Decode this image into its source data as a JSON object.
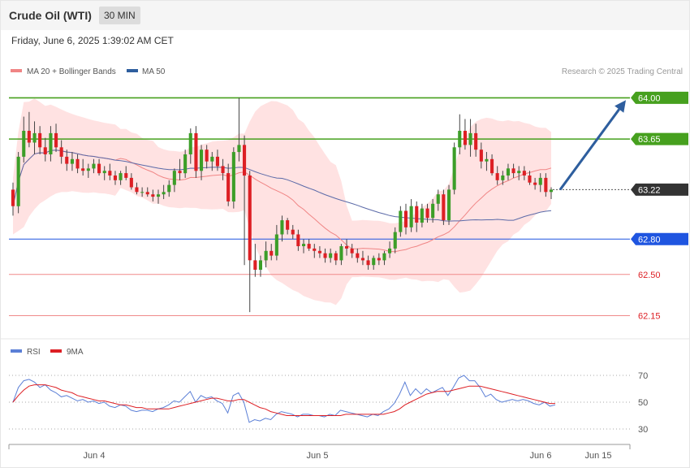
{
  "header": {
    "title": "Crude Oil (WTI)",
    "interval": "30 MIN",
    "timestamp": "Friday, June 6, 2025 1:39:02 AM CET"
  },
  "legend": {
    "ma20_label": "MA 20 + Bollinger Bands",
    "ma50_label": "MA 50",
    "copyright": "Research © 2025 Trading Central",
    "rsi_label": "RSI",
    "rsi_ma_label": "9MA"
  },
  "colors": {
    "up": "#3c9e28",
    "down": "#dd1f24",
    "ma20": "#f08585",
    "ma50": "#5b6aa8",
    "band_fill": "#ffdddd",
    "resistance": "#46a01e",
    "support": "#1f55e0",
    "target": "#f08a8a",
    "current": "#333333",
    "arrow": "#2e5e9e",
    "rsi": "#5b7fd6",
    "rsi_ma": "#dd1f24"
  },
  "chart_data": [
    {
      "type": "candlestick",
      "title": "Crude Oil (WTI)",
      "ylim": [
        62.05,
        64.12
      ],
      "x_ticks": [
        "Jun 4",
        "Jun 5",
        "Jun 6",
        "Jun 15"
      ],
      "levels": [
        {
          "value": 64.0,
          "label": "64.00",
          "kind": "resistance"
        },
        {
          "value": 63.65,
          "label": "63.65",
          "kind": "resistance"
        },
        {
          "value": 63.22,
          "label": "63.22",
          "kind": "current"
        },
        {
          "value": 62.8,
          "label": "62.80",
          "kind": "support"
        },
        {
          "value": 62.5,
          "label": "62.50",
          "kind": "target"
        },
        {
          "value": 62.15,
          "label": "62.15",
          "kind": "target"
        }
      ],
      "forecast_arrow": {
        "from": 63.22,
        "to": 63.98
      },
      "candles": [
        [
          63.22,
          63.28,
          63.0,
          63.08
        ],
        [
          63.08,
          63.54,
          63.02,
          63.5
        ],
        [
          63.5,
          63.84,
          63.45,
          63.72
        ],
        [
          63.72,
          63.88,
          63.58,
          63.62
        ],
        [
          63.62,
          63.8,
          63.52,
          63.7
        ],
        [
          63.7,
          63.76,
          63.52,
          63.58
        ],
        [
          63.58,
          63.66,
          63.46,
          63.52
        ],
        [
          63.52,
          63.76,
          63.46,
          63.7
        ],
        [
          63.7,
          63.78,
          63.54,
          63.58
        ],
        [
          63.58,
          63.64,
          63.44,
          63.5
        ],
        [
          63.5,
          63.56,
          63.38,
          63.44
        ],
        [
          63.44,
          63.54,
          63.38,
          63.48
        ],
        [
          63.48,
          63.52,
          63.36,
          63.4
        ],
        [
          63.4,
          63.48,
          63.34,
          63.38
        ],
        [
          63.38,
          63.44,
          63.32,
          63.4
        ],
        [
          63.4,
          63.48,
          63.36,
          63.44
        ],
        [
          63.44,
          63.48,
          63.34,
          63.36
        ],
        [
          63.36,
          63.42,
          63.3,
          63.38
        ],
        [
          63.38,
          63.44,
          63.3,
          63.34
        ],
        [
          63.34,
          63.38,
          63.26,
          63.3
        ],
        [
          63.3,
          63.38,
          63.26,
          63.36
        ],
        [
          63.36,
          63.42,
          63.3,
          63.32
        ],
        [
          63.32,
          63.36,
          63.22,
          63.24
        ],
        [
          63.24,
          63.28,
          63.18,
          63.2
        ],
        [
          63.2,
          63.24,
          63.16,
          63.2
        ],
        [
          63.2,
          63.24,
          63.16,
          63.18
        ],
        [
          63.18,
          63.22,
          63.12,
          63.16
        ],
        [
          63.16,
          63.22,
          63.1,
          63.18
        ],
        [
          63.18,
          63.26,
          63.14,
          63.2
        ],
        [
          63.2,
          63.3,
          63.16,
          63.26
        ],
        [
          63.26,
          63.4,
          63.2,
          63.38
        ],
        [
          63.38,
          63.48,
          63.3,
          63.36
        ],
        [
          63.36,
          63.56,
          63.32,
          63.52
        ],
        [
          63.52,
          63.74,
          63.44,
          63.7
        ],
        [
          63.7,
          63.76,
          63.32,
          63.38
        ],
        [
          63.38,
          63.6,
          63.3,
          63.56
        ],
        [
          63.56,
          63.6,
          63.4,
          63.46
        ],
        [
          63.46,
          63.54,
          63.38,
          63.5
        ],
        [
          63.5,
          63.56,
          63.38,
          63.42
        ],
        [
          63.42,
          63.48,
          63.3,
          63.36
        ],
        [
          63.36,
          63.44,
          63.08,
          63.12
        ],
        [
          63.12,
          63.58,
          63.06,
          63.54
        ],
        [
          63.54,
          64.0,
          63.46,
          63.6
        ],
        [
          63.6,
          63.68,
          62.58,
          63.34
        ],
        [
          63.34,
          63.38,
          62.18,
          62.62
        ],
        [
          62.62,
          62.76,
          62.48,
          62.54
        ],
        [
          62.54,
          62.66,
          62.48,
          62.62
        ],
        [
          62.62,
          62.78,
          62.56,
          62.7
        ],
        [
          62.7,
          62.76,
          62.62,
          62.66
        ],
        [
          62.66,
          62.92,
          62.62,
          62.84
        ],
        [
          62.84,
          63.0,
          62.78,
          62.96
        ],
        [
          62.96,
          62.98,
          62.84,
          62.88
        ],
        [
          62.88,
          62.92,
          62.8,
          62.84
        ],
        [
          62.84,
          62.88,
          62.7,
          62.74
        ],
        [
          62.74,
          62.8,
          62.68,
          62.76
        ],
        [
          62.76,
          62.8,
          62.7,
          62.72
        ],
        [
          62.72,
          62.76,
          62.64,
          62.7
        ],
        [
          62.7,
          62.74,
          62.64,
          62.68
        ],
        [
          62.68,
          62.72,
          62.6,
          62.64
        ],
        [
          62.64,
          62.72,
          62.6,
          62.68
        ],
        [
          62.68,
          62.7,
          62.58,
          62.62
        ],
        [
          62.62,
          62.76,
          62.58,
          62.74
        ],
        [
          62.74,
          62.8,
          62.66,
          62.72
        ],
        [
          62.72,
          62.76,
          62.64,
          62.68
        ],
        [
          62.68,
          62.72,
          62.6,
          62.64
        ],
        [
          62.64,
          62.7,
          62.58,
          62.62
        ],
        [
          62.62,
          62.66,
          62.54,
          62.58
        ],
        [
          62.58,
          62.66,
          62.54,
          62.64
        ],
        [
          62.64,
          62.68,
          62.58,
          62.62
        ],
        [
          62.62,
          62.7,
          62.58,
          62.68
        ],
        [
          62.68,
          62.78,
          62.64,
          62.72
        ],
        [
          62.72,
          62.9,
          62.68,
          62.86
        ],
        [
          62.86,
          63.08,
          62.82,
          63.04
        ],
        [
          63.04,
          63.1,
          62.84,
          62.9
        ],
        [
          62.9,
          63.14,
          62.86,
          63.08
        ],
        [
          63.08,
          63.12,
          62.86,
          62.94
        ],
        [
          62.94,
          63.1,
          62.9,
          63.06
        ],
        [
          63.06,
          63.1,
          62.94,
          62.98
        ],
        [
          62.98,
          63.14,
          62.94,
          63.1
        ],
        [
          63.1,
          63.22,
          63.04,
          63.18
        ],
        [
          63.18,
          63.22,
          62.92,
          62.96
        ],
        [
          62.96,
          63.26,
          62.92,
          63.22
        ],
        [
          63.22,
          63.62,
          63.18,
          63.58
        ],
        [
          63.58,
          63.86,
          63.52,
          63.72
        ],
        [
          63.72,
          63.82,
          63.56,
          63.6
        ],
        [
          63.6,
          63.82,
          63.5,
          63.7
        ],
        [
          63.7,
          63.78,
          63.5,
          63.56
        ],
        [
          63.56,
          63.62,
          63.4,
          63.46
        ],
        [
          63.46,
          63.54,
          63.38,
          63.48
        ],
        [
          63.48,
          63.52,
          63.34,
          63.36
        ],
        [
          63.36,
          63.42,
          63.26,
          63.3
        ],
        [
          63.3,
          63.38,
          63.26,
          63.34
        ],
        [
          63.34,
          63.44,
          63.3,
          63.4
        ],
        [
          63.4,
          63.44,
          63.32,
          63.36
        ],
        [
          63.36,
          63.42,
          63.3,
          63.38
        ],
        [
          63.38,
          63.42,
          63.3,
          63.34
        ],
        [
          63.34,
          63.38,
          63.26,
          63.28
        ],
        [
          63.28,
          63.32,
          63.22,
          63.26
        ],
        [
          63.26,
          63.36,
          63.2,
          63.32
        ],
        [
          63.32,
          63.36,
          63.16,
          63.2
        ],
        [
          63.2,
          63.24,
          63.14,
          63.22
        ]
      ]
    },
    {
      "type": "line",
      "title": "RSI",
      "ylim": [
        20,
        80
      ],
      "yticks": [
        30,
        50,
        70
      ],
      "series": [
        {
          "name": "RSI",
          "values": [
            50,
            61,
            66,
            67,
            65,
            61,
            63,
            59,
            57,
            54,
            55,
            53,
            51,
            52,
            50,
            51,
            49,
            50,
            47,
            46,
            48,
            47,
            44,
            43,
            44,
            44,
            43,
            45,
            46,
            48,
            51,
            50,
            54,
            58,
            50,
            55,
            53,
            54,
            51,
            49,
            42,
            55,
            57,
            50,
            35,
            37,
            36,
            38,
            37,
            41,
            43,
            42,
            41,
            39,
            41,
            41,
            40,
            40,
            39,
            41,
            40,
            44,
            43,
            42,
            41,
            40,
            39,
            41,
            40,
            43,
            45,
            49,
            56,
            65,
            55,
            60,
            56,
            60,
            57,
            59,
            61,
            55,
            61,
            68,
            70,
            66,
            66,
            61,
            54,
            56,
            52,
            50,
            51,
            52,
            51,
            52,
            51,
            49,
            48,
            50,
            47,
            48
          ]
        },
        {
          "name": "9MA",
          "values": [
            50,
            55,
            59,
            62,
            63,
            63,
            63,
            62,
            61,
            59,
            58,
            57,
            55,
            54,
            53,
            52,
            51,
            51,
            50,
            49,
            48,
            48,
            47,
            46,
            46,
            45,
            45,
            45,
            45,
            45,
            46,
            47,
            48,
            49,
            50,
            51,
            52,
            53,
            53,
            52,
            51,
            51,
            52,
            52,
            50,
            48,
            46,
            45,
            43,
            42,
            41,
            40,
            40,
            40,
            40,
            40,
            40,
            40,
            40,
            40,
            40,
            40,
            41,
            41,
            41,
            41,
            41,
            41,
            41,
            41,
            42,
            43,
            45,
            48,
            50,
            52,
            54,
            56,
            57,
            58,
            58,
            58,
            59,
            60,
            61,
            62,
            62,
            62,
            61,
            60,
            59,
            58,
            57,
            56,
            55,
            54,
            53,
            52,
            51,
            50,
            49,
            49
          ]
        }
      ]
    }
  ]
}
